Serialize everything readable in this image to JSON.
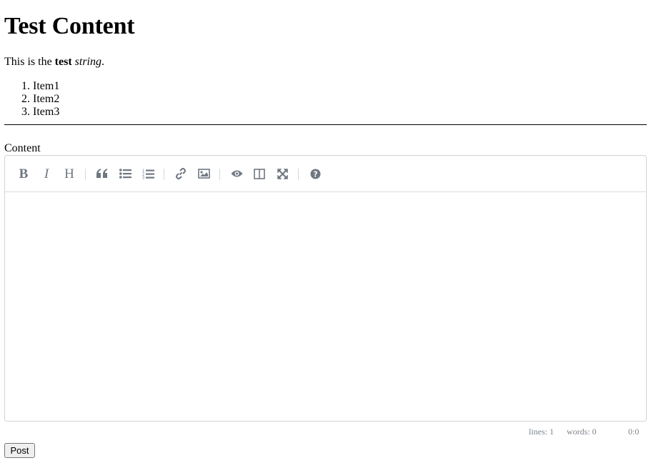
{
  "page": {
    "title": "Test Content",
    "intro": {
      "prefix": "This is the ",
      "bold": "test",
      "space": " ",
      "italic": "string",
      "suffix": "."
    },
    "list_items": [
      "Item1",
      "Item2",
      "Item3"
    ]
  },
  "editor": {
    "label": "Content",
    "toolbar": [
      {
        "name": "bold-button",
        "icon": "bold-icon"
      },
      {
        "name": "italic-button",
        "icon": "italic-icon"
      },
      {
        "name": "heading-button",
        "icon": "heading-icon"
      },
      {
        "name": "quote-button",
        "icon": "quote-icon"
      },
      {
        "name": "unordered-list-button",
        "icon": "unordered-list-icon"
      },
      {
        "name": "ordered-list-button",
        "icon": "ordered-list-icon"
      },
      {
        "name": "link-button",
        "icon": "link-icon"
      },
      {
        "name": "image-button",
        "icon": "image-icon"
      },
      {
        "name": "preview-button",
        "icon": "eye-icon"
      },
      {
        "name": "side-by-side-button",
        "icon": "columns-icon"
      },
      {
        "name": "fullscreen-button",
        "icon": "fullscreen-icon"
      },
      {
        "name": "guide-button",
        "icon": "question-icon"
      }
    ],
    "status": {
      "lines": "lines: 1",
      "words": "words: 0",
      "cursor": "0:0"
    }
  },
  "form": {
    "submit_label": "Post"
  }
}
